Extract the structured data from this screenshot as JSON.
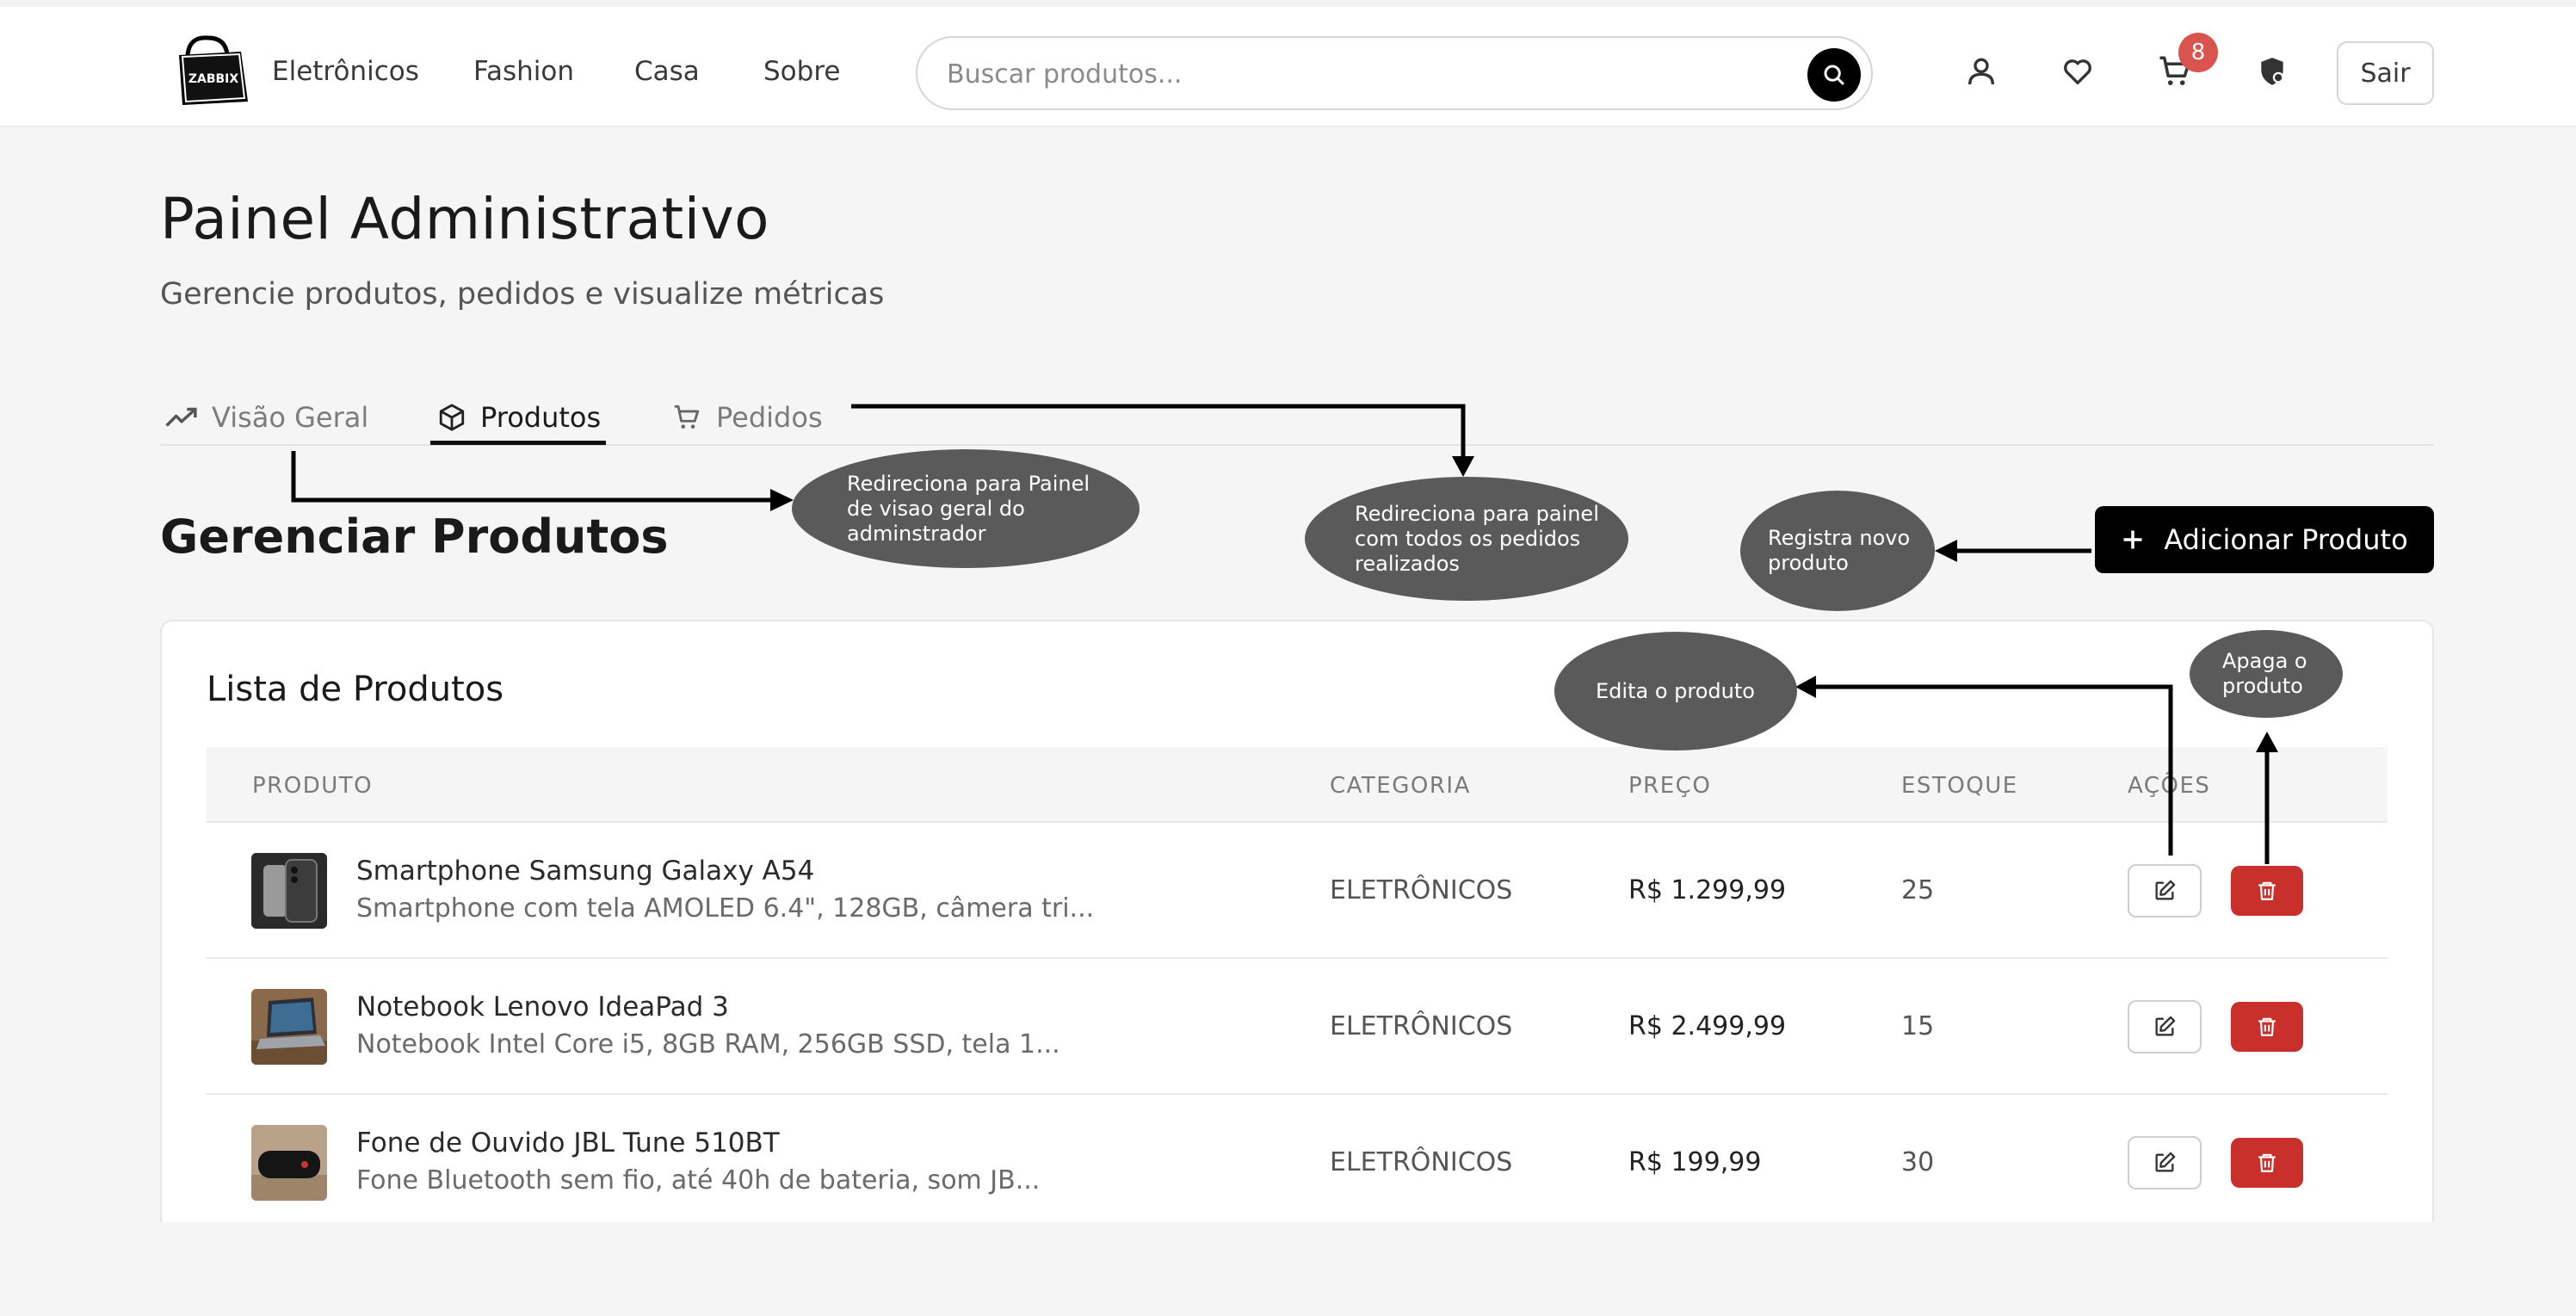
{
  "header": {
    "logo_text": "ZABBIX",
    "nav": [
      "Eletrônicos",
      "Fashion",
      "Casa",
      "Sobre"
    ],
    "search_placeholder": "Buscar produtos...",
    "cart_count": "8",
    "logout_label": "Sair"
  },
  "page": {
    "title": "Painel Administrativo",
    "subtitle": "Gerencie produtos, pedidos e visualize métricas"
  },
  "tabs": [
    {
      "label": "Visão Geral",
      "icon": "trending-up-icon"
    },
    {
      "label": "Produtos",
      "icon": "package-icon"
    },
    {
      "label": "Pedidos",
      "icon": "cart-icon"
    }
  ],
  "section": {
    "title": "Gerenciar Produtos",
    "add_button": "Adicionar Produto"
  },
  "table": {
    "title": "Lista de Produtos",
    "headers": [
      "PRODUTO",
      "CATEGORIA",
      "PREÇO",
      "ESTOQUE",
      "AÇÕES"
    ],
    "rows": [
      {
        "name": "Smartphone Samsung Galaxy A54",
        "desc": "Smartphone com tela AMOLED 6.4\", 128GB, câmera tri...",
        "category": "ELETRÔNICOS",
        "price": "R$ 1.299,99",
        "stock": "25"
      },
      {
        "name": "Notebook Lenovo IdeaPad 3",
        "desc": "Notebook Intel Core i5, 8GB RAM, 256GB SSD, tela 1...",
        "category": "ELETRÔNICOS",
        "price": "R$ 2.499,99",
        "stock": "15"
      },
      {
        "name": "Fone de Ouvido JBL Tune 510BT",
        "desc": "Fone Bluetooth sem fio, até 40h de bateria, som JB...",
        "category": "ELETRÔNICOS",
        "price": "R$ 199,99",
        "stock": "30"
      }
    ]
  },
  "annotations": {
    "overview": "Redireciona para Painel de visao geral do adminstrador",
    "orders": "Redireciona para painel com todos os pedidos realizados",
    "register": "Registra novo produto",
    "edit": "Edita o produto",
    "delete": "Apaga o produto"
  },
  "colors": {
    "primary": "#000000",
    "danger": "#c9302c",
    "badge": "#d9534f",
    "annotation": "#5a5a5a"
  }
}
